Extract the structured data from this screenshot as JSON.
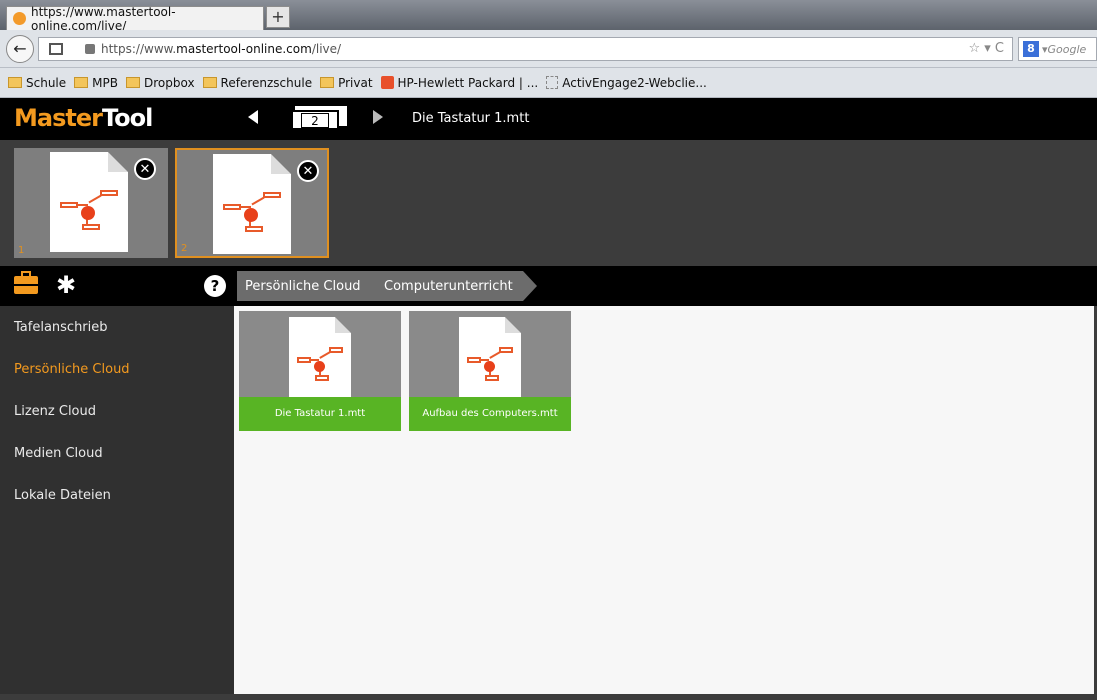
{
  "browser": {
    "tab_title": "https://www.mastertool-online.com/live/",
    "new_tab_label": "+",
    "url_prefix": "https://www.",
    "url_domain": "mastertool-online.com",
    "url_suffix": "/live/",
    "search_placeholder": "Google",
    "bookmarks": [
      {
        "label": "Schule",
        "icon": "folder-icon"
      },
      {
        "label": "MPB",
        "icon": "folder-icon"
      },
      {
        "label": "Dropbox",
        "icon": "folder-icon"
      },
      {
        "label": "Referenzschule",
        "icon": "folder-icon"
      },
      {
        "label": "Privat",
        "icon": "folder-icon"
      },
      {
        "label": "HP-Hewlett Packard | ...",
        "icon": "hp-icon"
      },
      {
        "label": "ActivEngage2-Webclie...",
        "icon": "page-icon"
      }
    ]
  },
  "app": {
    "logo_part1": "Master",
    "logo_part2": "Tool",
    "page_count": "2",
    "document_title": "Die Tastatur 1.mtt",
    "thumbnails": [
      {
        "number": "1",
        "active": false
      },
      {
        "number": "2",
        "active": true
      }
    ],
    "breadcrumb": [
      "Persönliche Cloud",
      "Computerunterricht"
    ],
    "sidebar": [
      {
        "label": "Tafelanschrieb",
        "active": false
      },
      {
        "label": "Persönliche Cloud",
        "active": true
      },
      {
        "label": "Lizenz Cloud",
        "active": false
      },
      {
        "label": "Medien Cloud",
        "active": false
      },
      {
        "label": "Lokale Dateien",
        "active": false
      }
    ],
    "files": [
      {
        "name": "Die Tastatur 1.mtt"
      },
      {
        "name": "Aufbau des Computers.mtt"
      }
    ],
    "colors": {
      "accent": "#f39a1f",
      "file_label_green": "#58b424",
      "mindmap_red": "#e8401a"
    }
  }
}
